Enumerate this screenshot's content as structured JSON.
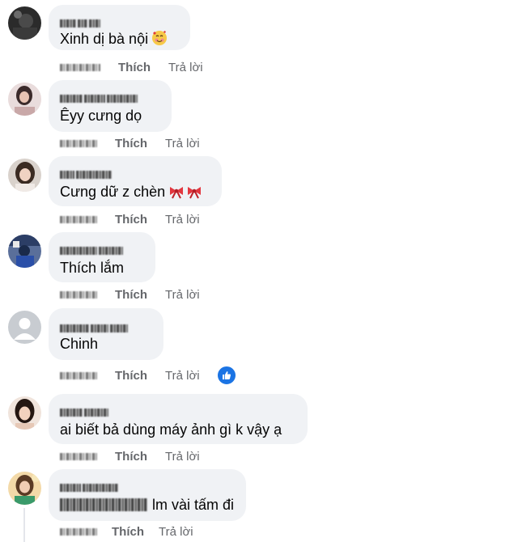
{
  "like_label": "Thích",
  "reply_label": "Trả lời",
  "comments": [
    {
      "text": "Xinh dị bà nội",
      "emoji": "smiling-face-with-hearts"
    },
    {
      "text": "Êyy cưng dọ"
    },
    {
      "text": "Cưng dữ z chèn",
      "emoji": "ribbon-bows"
    },
    {
      "text": "Thích lắm"
    },
    {
      "text": "Chinh",
      "reaction": "like"
    },
    {
      "text": "ai biết bả dùng máy ảnh gì k vậy ạ"
    },
    {
      "text": "lm vài tấm đi"
    }
  ],
  "colors": {
    "bubble": "#f0f2f5",
    "meta_text": "#65676b",
    "like_blue": "#1b74e4"
  }
}
